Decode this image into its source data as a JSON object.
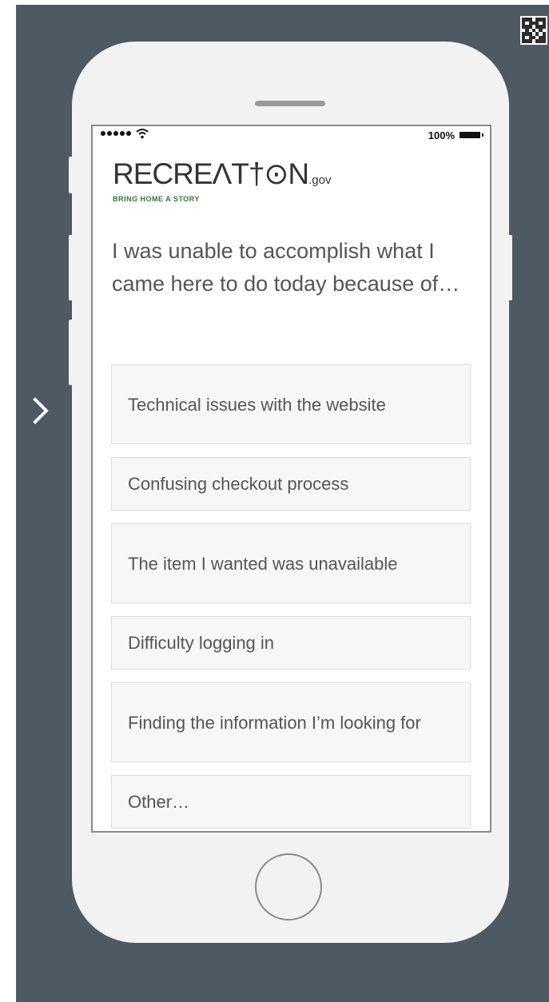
{
  "status_bar": {
    "battery_text": "100%"
  },
  "logo": {
    "wordmark": "RECREΛT†⊙N",
    "suffix": ".gov",
    "tagline": "BRING HOME A STORY",
    "tagline_color": "#2f7d32"
  },
  "question": "I was unable to accomplish what I came here to do today because of…",
  "options": [
    {
      "label": "Technical issues with the website"
    },
    {
      "label": "Confusing checkout process"
    },
    {
      "label": "The item I wanted was unavailable"
    },
    {
      "label": "Difficulty logging in"
    },
    {
      "label": "Finding the information I’m looking for"
    },
    {
      "label": "Other…"
    }
  ],
  "icons": {
    "next": "chevron-right-icon",
    "qr": "qr-code-icon",
    "home": "home-button-icon"
  },
  "colors": {
    "background": "#4d5a63",
    "phone_body": "#f2f2f2",
    "option_bg": "#f7f7f7",
    "text": "#555555",
    "brand_green": "#2f7d32"
  }
}
